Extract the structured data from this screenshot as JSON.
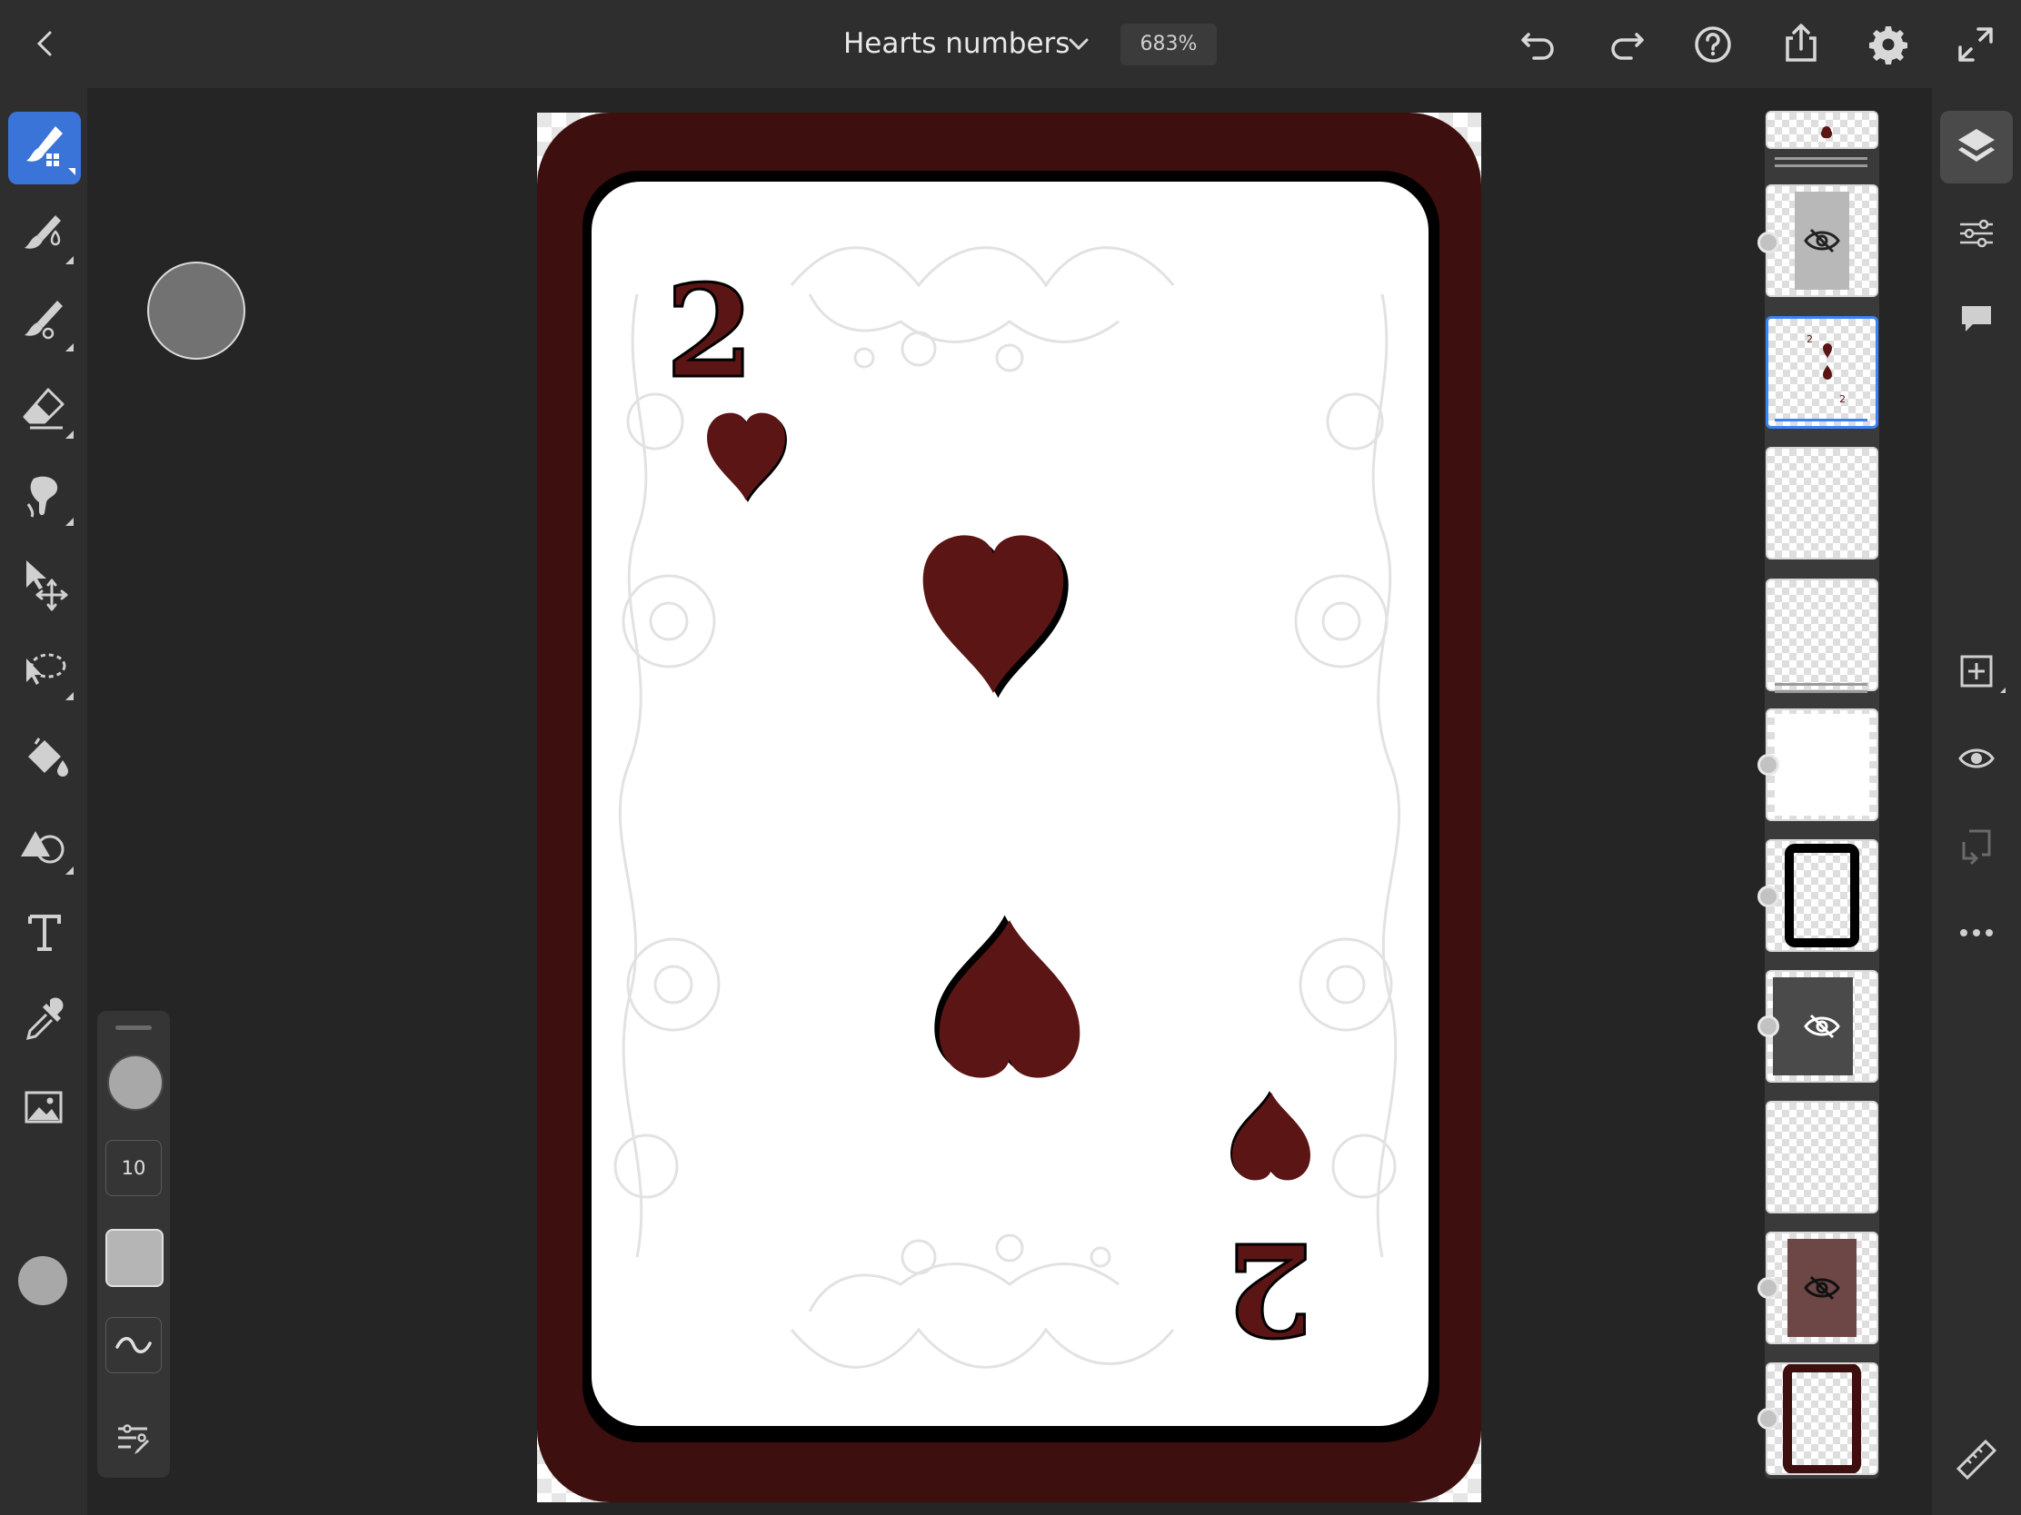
{
  "header": {
    "document_title": "Hearts numbers",
    "zoom_level": "683%",
    "back_icon": "chevron-left-icon",
    "undo_icon": "undo-icon",
    "redo_icon": "redo-icon",
    "help_icon": "help-icon",
    "share_icon": "share-icon",
    "settings_icon": "gear-icon",
    "fullscreen_icon": "expand-icon"
  },
  "tools": [
    {
      "name": "pixel-brush-tool",
      "icon": "pixel-brush-icon",
      "active": true
    },
    {
      "name": "live-brush-tool",
      "icon": "live-brush-icon"
    },
    {
      "name": "vector-brush-tool",
      "icon": "vector-brush-icon"
    },
    {
      "name": "eraser-tool",
      "icon": "eraser-icon"
    },
    {
      "name": "smudge-tool",
      "icon": "smudge-icon"
    },
    {
      "name": "transform-tool",
      "icon": "move-icon"
    },
    {
      "name": "lasso-tool",
      "icon": "lasso-icon"
    },
    {
      "name": "fill-tool",
      "icon": "paint-bucket-icon"
    },
    {
      "name": "shape-tool",
      "icon": "shape-icon"
    },
    {
      "name": "text-tool",
      "icon": "text-icon"
    },
    {
      "name": "eyedropper-tool",
      "icon": "eyedropper-icon"
    },
    {
      "name": "place-image-tool",
      "icon": "image-icon"
    }
  ],
  "current_color": "#a8a8a8",
  "brush_settings": {
    "size": "10"
  },
  "card": {
    "rank": "2",
    "suit": "hearts",
    "border_color": "#3d0f0e",
    "suit_color": "#5a1514"
  },
  "layers": [
    {
      "name": "layer-top-partial"
    },
    {
      "name": "layer-hidden-gray",
      "hidden": true
    },
    {
      "name": "layer-card-pips",
      "selected": true
    },
    {
      "name": "layer-empty-1"
    },
    {
      "name": "layer-floral-group"
    },
    {
      "name": "layer-white-fill"
    },
    {
      "name": "layer-black-frame"
    },
    {
      "name": "layer-hidden-dark",
      "hidden": true
    },
    {
      "name": "layer-empty-2"
    },
    {
      "name": "layer-hidden-brown",
      "hidden": true
    },
    {
      "name": "layer-red-frame"
    }
  ],
  "right_tools": [
    {
      "name": "layers-button",
      "icon": "layers-icon",
      "active": true
    },
    {
      "name": "layer-properties-button",
      "icon": "sliders-icon"
    },
    {
      "name": "comments-button",
      "icon": "comment-icon"
    },
    {
      "name": "add-layer-button",
      "icon": "add-layer-icon"
    },
    {
      "name": "visibility-button",
      "icon": "eye-icon"
    },
    {
      "name": "merge-down-button",
      "icon": "merge-down-icon"
    },
    {
      "name": "more-button",
      "icon": "more-icon"
    },
    {
      "name": "ruler-button",
      "icon": "ruler-icon"
    }
  ]
}
